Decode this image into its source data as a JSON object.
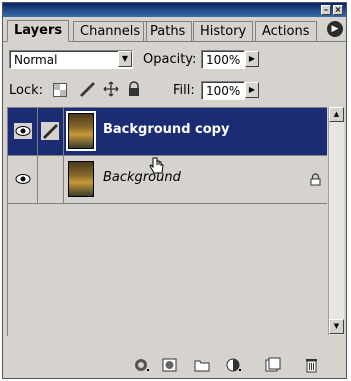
{
  "tabs": [
    "Layers",
    "Channels",
    "Paths",
    "History",
    "Actions"
  ],
  "blend_mode": "Normal",
  "opacity": {
    "label": "Opacity:",
    "value": "100%"
  },
  "lock": {
    "label": "Lock:"
  },
  "fill": {
    "label": "Fill:",
    "value": "100%"
  },
  "layers": [
    {
      "name": "Background copy",
      "selected": true,
      "visible": true
    },
    {
      "name": "Background",
      "selected": false,
      "visible": true,
      "locked": true
    }
  ],
  "colors": {
    "selection": "#1c2c74",
    "panel": "#d6d3ce",
    "titlebar": "#0a246a"
  }
}
